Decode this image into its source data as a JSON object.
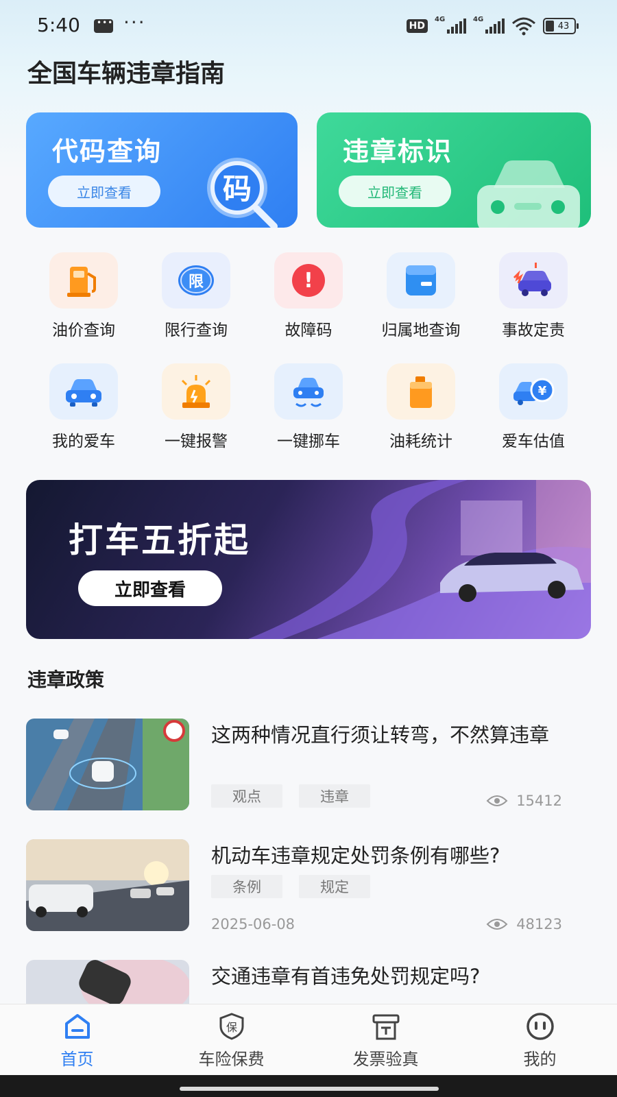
{
  "status_bar": {
    "time": "5:40",
    "hd": "HD",
    "network_1": "4G",
    "network_2": "4G",
    "battery": "43"
  },
  "page": {
    "title": "全国车辆违章指南"
  },
  "hero_cards": [
    {
      "title": "代码查询",
      "button": "立即查看",
      "icon": "magnifier-code-icon",
      "icon_text": "码",
      "color": "#2f7ff2"
    },
    {
      "title": "违章标识",
      "button": "立即查看",
      "icon": "car-icon",
      "color": "#1fbf7a"
    }
  ],
  "quick_tools": [
    {
      "label": "油价查询",
      "icon": "fuel-pump-icon"
    },
    {
      "label": "限行查询",
      "icon": "restriction-icon",
      "icon_text": "限"
    },
    {
      "label": "故障码",
      "icon": "warning-icon",
      "icon_text": "!"
    },
    {
      "label": "归属地查询",
      "icon": "wallet-icon"
    },
    {
      "label": "事故定责",
      "icon": "accident-car-icon"
    },
    {
      "label": "我的爱车",
      "icon": "my-car-icon"
    },
    {
      "label": "一键报警",
      "icon": "alarm-light-icon"
    },
    {
      "label": "一键挪车",
      "icon": "move-car-icon"
    },
    {
      "label": "油耗统计",
      "icon": "oil-can-icon"
    },
    {
      "label": "爱车估值",
      "icon": "car-valuation-icon",
      "icon_text": "¥"
    }
  ],
  "banner": {
    "title": "打车五折起",
    "button": "立即查看"
  },
  "policy_section": {
    "title": "违章政策",
    "articles": [
      {
        "title": "这两种情况直行须让转弯，不然算违章",
        "tags": [
          "观点",
          "违章"
        ],
        "date": "",
        "views": "15412"
      },
      {
        "title": "机动车违章规定处罚条例有哪些?",
        "tags": [
          "条例",
          "规定"
        ],
        "date": "2025-06-08",
        "views": "48123"
      },
      {
        "title": "交通违章有首违免处罚规定吗?",
        "tags": [
          "",
          ""
        ],
        "date": "",
        "views": ""
      }
    ]
  },
  "tab_bar": {
    "tabs": [
      {
        "label": "首页",
        "icon": "home-icon",
        "active": true
      },
      {
        "label": "车险保费",
        "icon": "insurance-shield-icon",
        "icon_text": "保",
        "active": false
      },
      {
        "label": "发票验真",
        "icon": "invoice-icon",
        "active": false
      },
      {
        "label": "我的",
        "icon": "profile-icon",
        "active": false
      }
    ]
  },
  "colors": {
    "accent": "#2f7ff2",
    "green": "#1fbf7a",
    "text": "#222222",
    "muted": "#999999"
  }
}
